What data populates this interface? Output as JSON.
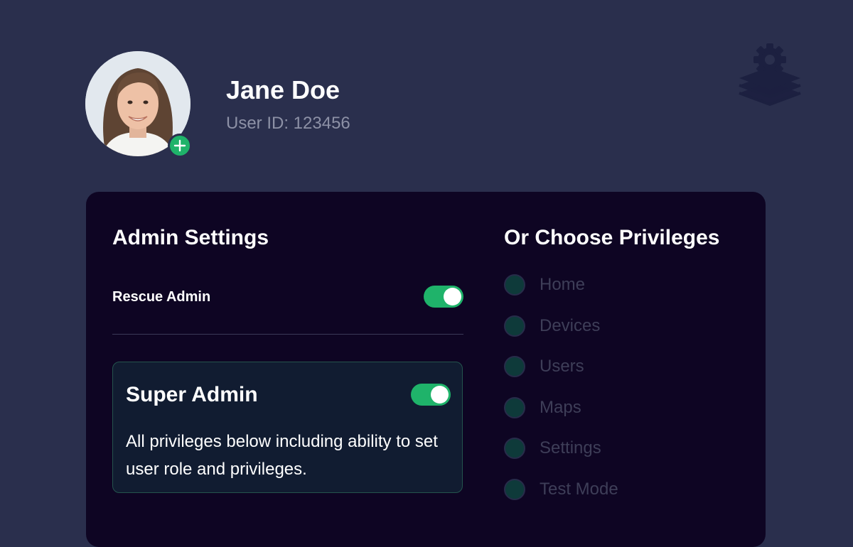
{
  "user": {
    "name": "Jane Doe",
    "id_text": "User ID: 123456"
  },
  "icons": {
    "avatar": "user-photo",
    "avatar_add": "plus-icon",
    "settings": "layers-gear-icon"
  },
  "admin_settings": {
    "title": "Admin Settings",
    "rescue_admin": {
      "label": "Rescue Admin",
      "enabled": true
    },
    "super_admin": {
      "title": "Super Admin",
      "enabled": true,
      "description": "All privileges below including ability to set user role and privileges."
    }
  },
  "privileges": {
    "title": "Or Choose Privileges",
    "items": [
      {
        "label": "Home",
        "selected": false
      },
      {
        "label": "Devices",
        "selected": false
      },
      {
        "label": "Users",
        "selected": false
      },
      {
        "label": "Maps",
        "selected": false
      },
      {
        "label": "Settings",
        "selected": false
      },
      {
        "label": "Test Mode",
        "selected": false
      }
    ]
  },
  "colors": {
    "background": "#2a2f4d",
    "panel": "#0e0523",
    "accent_green": "#1fb36a",
    "card": "#111c31",
    "card_border": "#24544d",
    "muted_text": "#8d91a6",
    "disabled_text": "#3e3e58"
  }
}
